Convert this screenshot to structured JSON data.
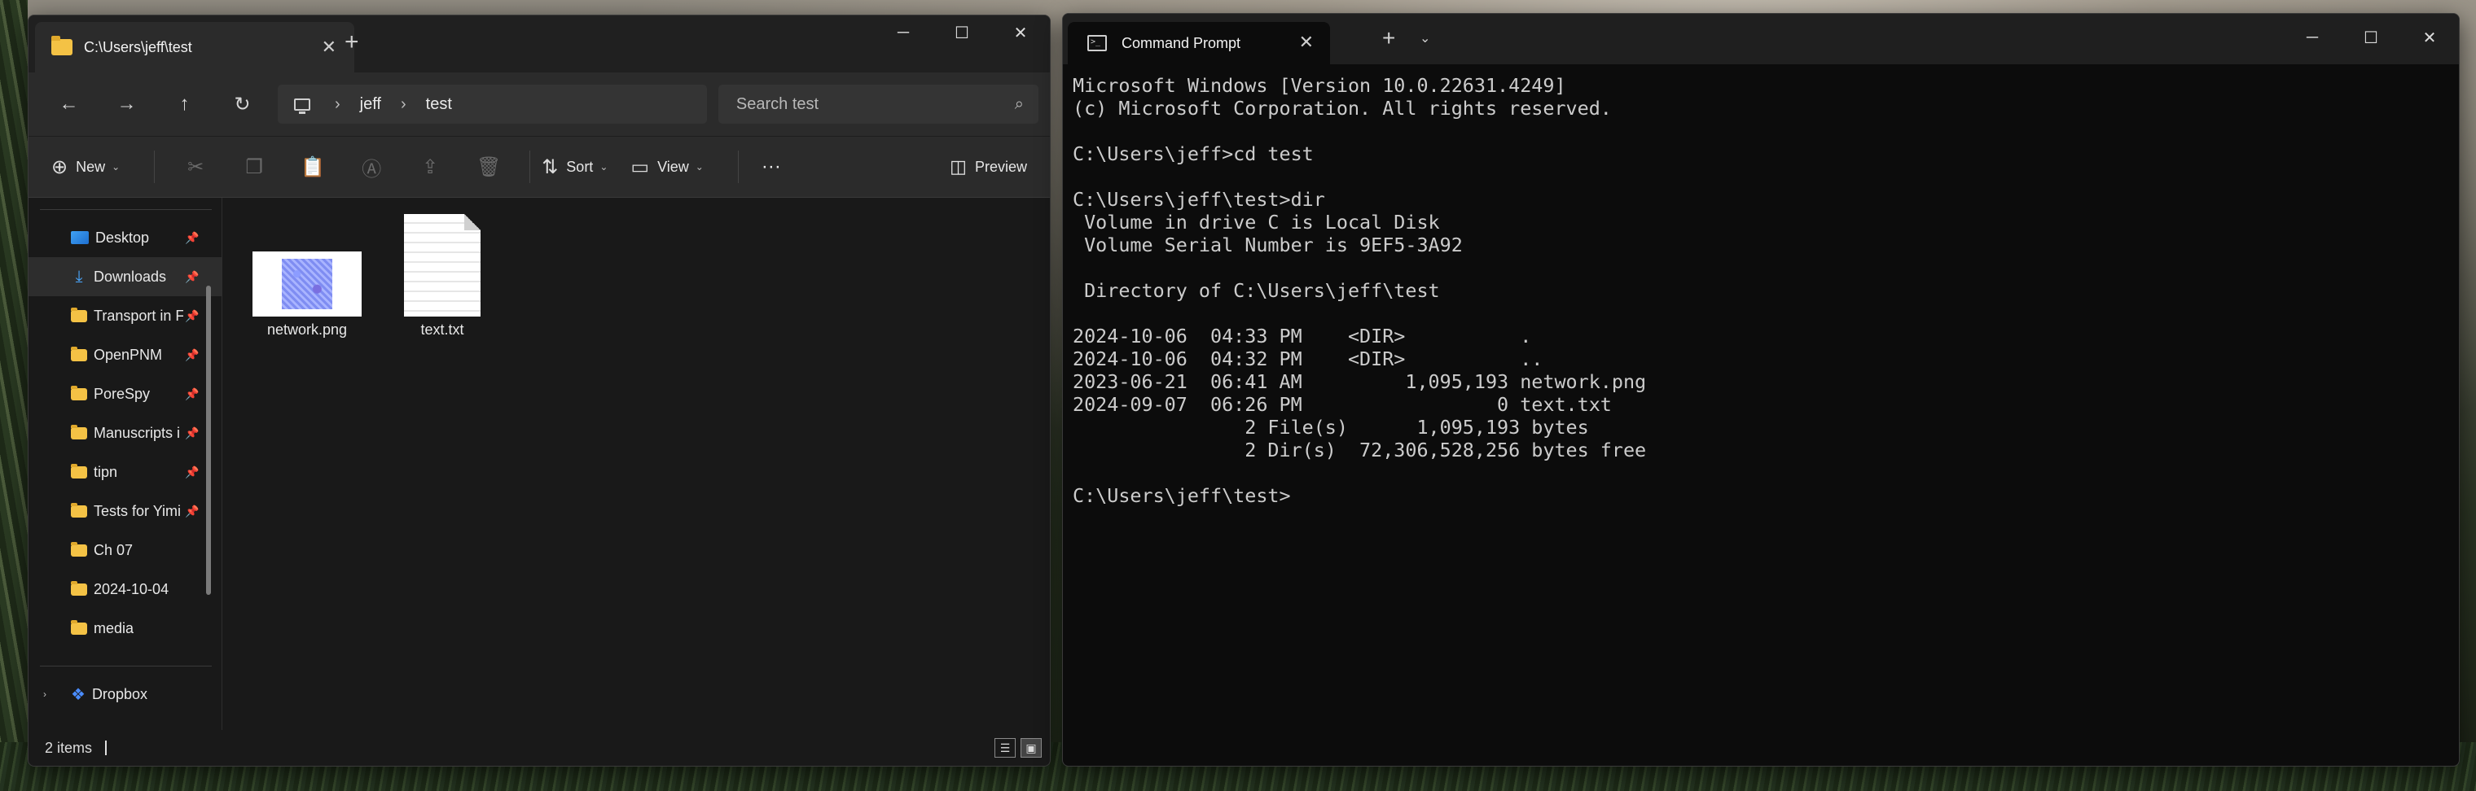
{
  "explorer": {
    "tab_title": "C:\\Users\\jeff\\test",
    "tab_close": "✕",
    "new_tab": "+",
    "caption": {
      "minimize": "─",
      "maximize": "☐",
      "close": "✕"
    },
    "nav": {
      "back": "←",
      "forward": "→",
      "up": "↑",
      "refresh": "↻"
    },
    "breadcrumb": [
      "jeff",
      "test"
    ],
    "breadcrumb_sep": "›",
    "search_placeholder": "Search test",
    "toolbar": {
      "new_label": "New",
      "sort_label": "Sort",
      "view_label": "View",
      "preview_label": "Preview",
      "more": "···"
    },
    "sidebar": [
      {
        "label": "Desktop",
        "icon": "desktop-icon",
        "pinned": true
      },
      {
        "label": "Downloads",
        "icon": "download-icon",
        "pinned": true,
        "selected": true
      },
      {
        "label": "Transport in F",
        "icon": "folder-icon",
        "pinned": true
      },
      {
        "label": "OpenPNM",
        "icon": "folder-icon",
        "pinned": true
      },
      {
        "label": "PoreSpy",
        "icon": "folder-icon",
        "pinned": true
      },
      {
        "label": "Manuscripts i",
        "icon": "folder-icon",
        "pinned": true
      },
      {
        "label": "tipn",
        "icon": "folder-icon",
        "pinned": true
      },
      {
        "label": "Tests for Yimi",
        "icon": "folder-icon",
        "pinned": true
      },
      {
        "label": "Ch 07",
        "icon": "folder-icon",
        "pinned": false
      },
      {
        "label": "2024-10-04",
        "icon": "folder-icon",
        "pinned": false
      },
      {
        "label": "media",
        "icon": "folder-icon",
        "pinned": false
      }
    ],
    "dropbox_label": "Dropbox",
    "files": [
      {
        "name": "network.png",
        "type": "image"
      },
      {
        "name": "text.txt",
        "type": "text"
      }
    ],
    "status": "2 items"
  },
  "cmd": {
    "tab_title": "Command Prompt",
    "tab_close": "✕",
    "new_tab": "+",
    "dropdown": "⌄",
    "caption": {
      "minimize": "─",
      "maximize": "☐",
      "close": "✕"
    },
    "lines": [
      "Microsoft Windows [Version 10.0.22631.4249]",
      "(c) Microsoft Corporation. All rights reserved.",
      "",
      "C:\\Users\\jeff>cd test",
      "",
      "C:\\Users\\jeff\\test>dir",
      " Volume in drive C is Local Disk",
      " Volume Serial Number is 9EF5-3A92",
      "",
      " Directory of C:\\Users\\jeff\\test",
      "",
      "2024-10-06  04:33 PM    <DIR>          .",
      "2024-10-06  04:32 PM    <DIR>          ..",
      "2023-06-21  06:41 AM         1,095,193 network.png",
      "2024-09-07  06:26 PM                 0 text.txt",
      "               2 File(s)      1,095,193 bytes",
      "               2 Dir(s)  72,306,528,256 bytes free",
      "",
      "C:\\Users\\jeff\\test>"
    ]
  }
}
